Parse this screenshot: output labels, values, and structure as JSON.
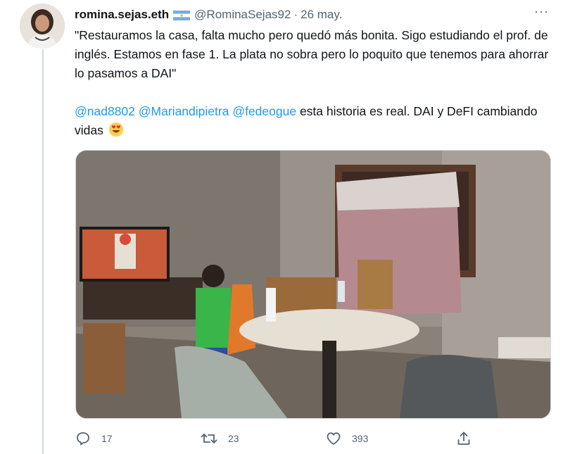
{
  "tweet": {
    "author": {
      "display_name": "romina.sejas.eth",
      "flag_icon": "argentina-flag-icon",
      "handle": "@RominaSejas92",
      "separator": "·",
      "date": "26 may."
    },
    "more_label": "···",
    "text": {
      "line1": "\"Restauramos la casa, falta mucho pero quedó más bonita. Sigo estudiando el prof. de inglés. Estamos en fase 1. La plata no sobra pero lo poquito que tenemos para ahorrar lo pasamos a DAI\"",
      "mention1": "@nad8802",
      "mention2": "@Mariandipietra",
      "mention3": "@fedeogue",
      "line2_rest": " esta historia es real. DAI y DeFI cambiando vidas ",
      "emoji_icon": "heart-eyes-emoji"
    },
    "actions": {
      "reply": {
        "icon": "reply-icon",
        "count": "17"
      },
      "retweet": {
        "icon": "retweet-icon",
        "count": "23"
      },
      "like": {
        "icon": "heart-icon",
        "count": "393"
      },
      "share": {
        "icon": "share-icon"
      }
    }
  },
  "colors": {
    "link": "#1d9bf0",
    "secondary_text": "#536471",
    "primary_text": "#0f1419",
    "thread_line": "#cfd9de"
  }
}
